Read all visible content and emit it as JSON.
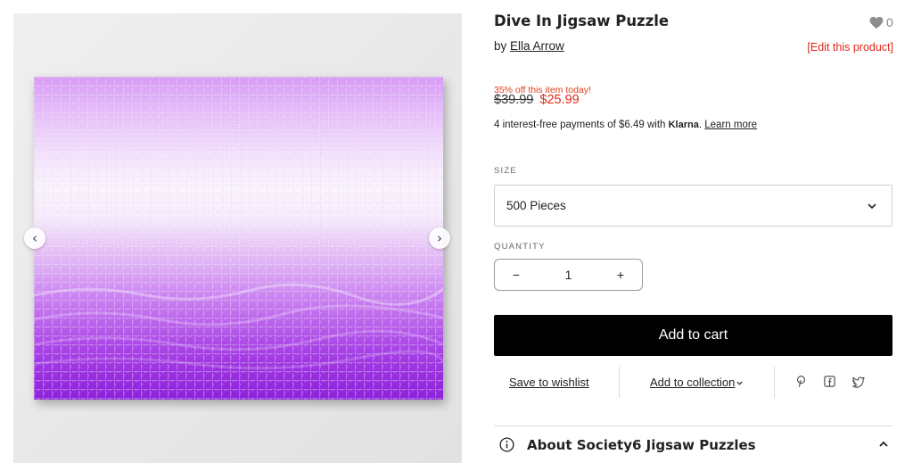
{
  "gallery": {
    "prev_icon": "chevron-left-icon",
    "next_icon": "chevron-right-icon",
    "prev_glyph": "‹",
    "next_glyph": "›",
    "image_colors": {
      "top": "#d89cf6",
      "middle": "#faf3fd",
      "bottom": "#8e22dc"
    }
  },
  "product": {
    "title": "Dive In Jigsaw Puzzle",
    "likes": "0",
    "by_prefix": "by",
    "artist": "Ella Arrow",
    "edit_link": "[Edit this product]",
    "promo": "35% off this item today!",
    "price_old": "$39.99",
    "price_new": "$25.99",
    "klarna": {
      "prefix": "4 interest-free payments of $6.49 with",
      "brand": "Klarna",
      "suffix": ".",
      "learn_more": "Learn more"
    },
    "size": {
      "label": "SIZE",
      "selected": "500 Pieces"
    },
    "quantity": {
      "label": "QUANTITY",
      "minus": "−",
      "value": "1",
      "plus": "+"
    },
    "add_to_cart": "Add to cart",
    "actions": {
      "save_to_wishlist": "Save to wishlist",
      "add_to_collection": "Add to collection",
      "share_icons": [
        "pinterest-icon",
        "facebook-icon",
        "twitter-icon"
      ]
    },
    "about": {
      "title": "About Society6 Jigsaw Puzzles"
    }
  },
  "colors": {
    "accent_red": "#e0291b",
    "cart_button": "#000000",
    "text": "#222222"
  }
}
